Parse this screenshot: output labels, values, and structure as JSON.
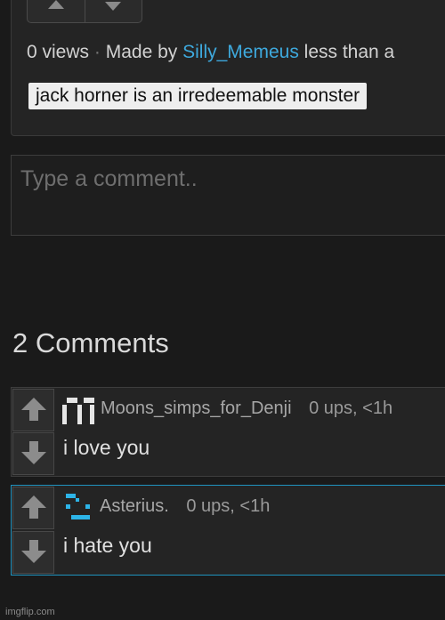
{
  "post": {
    "views": "0 views",
    "separator": "·",
    "made_by": "Made by",
    "author": "Silly_Memeus",
    "time": "less than a",
    "tag": "jack horner is an irredeemable monster"
  },
  "comment_input": {
    "placeholder": "Type a comment.."
  },
  "comments_header": "2 Comments",
  "comments": [
    {
      "username": "Moons_simps_for_Denji",
      "ups": "0 ups, <1h",
      "text": "i love you"
    },
    {
      "username": "Asterius.",
      "ups": "0 ups, <1h",
      "text": "i hate you"
    }
  ],
  "watermark": "imgflip.com",
  "colors": {
    "link": "#3ea9dd",
    "highlight_border": "#1f93bf",
    "background": "#1a1a1a"
  }
}
